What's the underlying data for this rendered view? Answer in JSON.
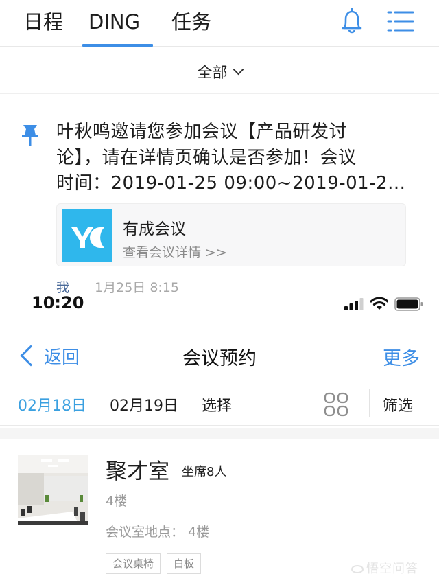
{
  "ding_app": {
    "tabs": [
      {
        "label": "日程",
        "active": false
      },
      {
        "label": "DING",
        "active": true
      },
      {
        "label": "任务",
        "active": false
      }
    ],
    "accent_color": "#3d8ee6",
    "header_icons": [
      "bell-icon",
      "menu-list-icon"
    ],
    "filter": {
      "label": "全部",
      "icon": "chevron-down-icon"
    },
    "message": {
      "pinned": true,
      "lines": [
        "叶秋鸣邀请您参加会议【产品研发讨",
        "论】，请在详情页确认是否参加！会议",
        "时间：2019-01-25 09:00~2019-01-2..."
      ],
      "card": {
        "logo_text": "YC",
        "logo_color": "#2fb7ec",
        "title": "有成会议",
        "link": "查看会议详情 >>"
      },
      "sender": "我",
      "timestamp": "1月25日 8:15"
    }
  },
  "booking_app": {
    "status_bar": {
      "time": "10:20",
      "icons": [
        "signal-icon",
        "wifi-icon",
        "battery-icon"
      ]
    },
    "nav": {
      "back_label": "返回",
      "title": "会议预约",
      "more_label": "更多"
    },
    "date_bar": {
      "dates": [
        {
          "label": "02月18日",
          "selected": true
        },
        {
          "label": "02月19日",
          "selected": false
        }
      ],
      "choose_label": "选择",
      "view_icon": "grid-view-icon",
      "filter_label": "筛选",
      "selected_color": "#3aa0e0"
    },
    "rooms": [
      {
        "name": "聚才室",
        "seats": "坐席8人",
        "floor": "4楼",
        "location": "会议室地点： 4楼",
        "tags": [
          "会议桌椅",
          "白板"
        ]
      }
    ]
  },
  "watermark": "悟空问答"
}
